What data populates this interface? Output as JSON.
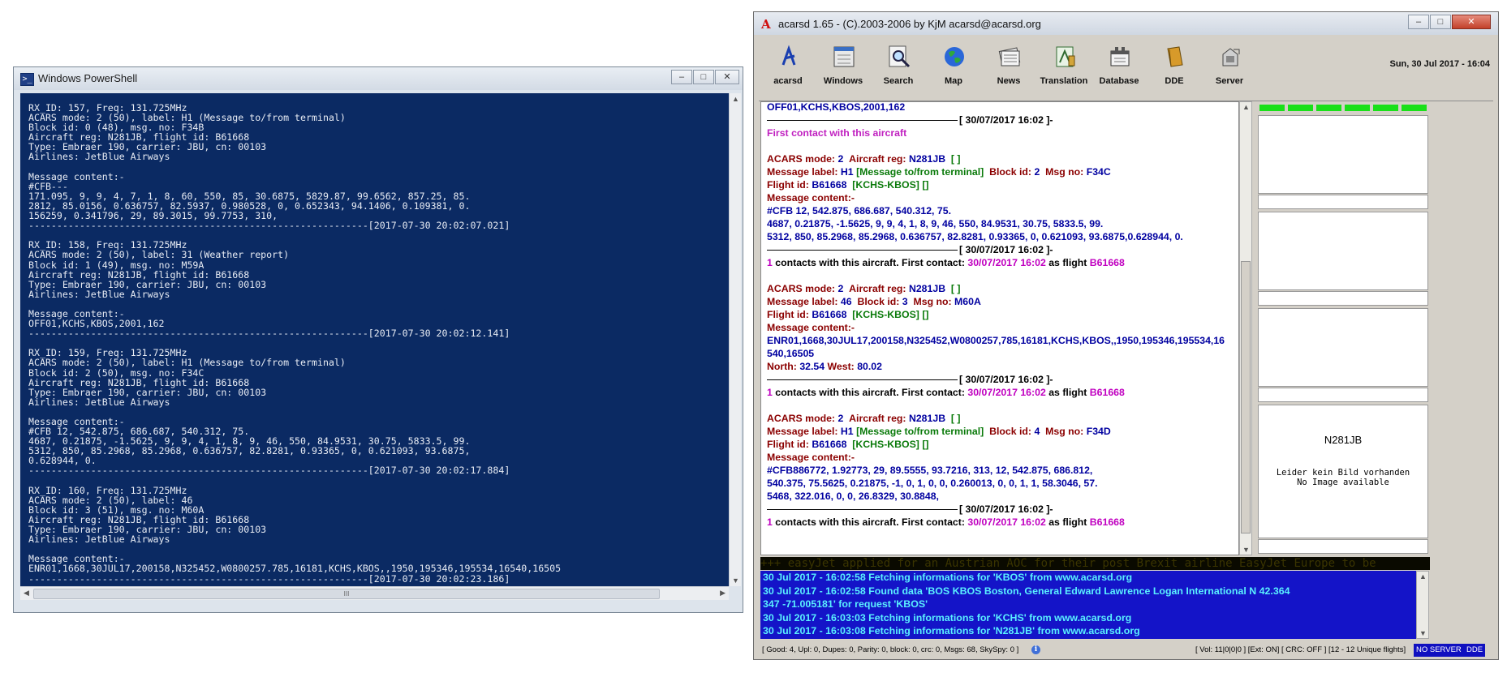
{
  "powershell": {
    "title": "Windows PowerShell",
    "lines": [
      "RX_ID: 157, Freq: 131.725MHz",
      "ACARS mode: 2 (50), label: H1 (Message to/from terminal)",
      "Block id: 0 (48), msg. no: F34B",
      "Aircraft reg: N281JB, flight id: B61668",
      "Type: Embraer 190, carrier: JBU, cn: 00103",
      "Airlines: JetBlue Airways",
      "",
      "Message content:-",
      "#CFB---",
      "171.095, 9, 9, 4, 7, 1, 8, 60, 550, 85, 30.6875, 5829.87, 99.6562, 857.25, 85.",
      "2812, 85.0156, 0.636757, 82.5937, 0.980528, 0, 0.652343, 94.1406, 0.109381, 0.",
      "156259, 0.341796, 29, 89.3015, 99.7753, 310,",
      "------------------------------------------------------------[2017-07-30 20:02:07.021]",
      "",
      "RX_ID: 158, Freq: 131.725MHz",
      "ACARS mode: 2 (50), label: 31 (Weather report)",
      "Block id: 1 (49), msg. no: M59A",
      "Aircraft reg: N281JB, flight id: B61668",
      "Type: Embraer 190, carrier: JBU, cn: 00103",
      "Airlines: JetBlue Airways",
      "",
      "Message content:-",
      "OFF01,KCHS,KBOS,2001,162",
      "------------------------------------------------------------[2017-07-30 20:02:12.141]",
      "",
      "RX_ID: 159, Freq: 131.725MHz",
      "ACARS mode: 2 (50), label: H1 (Message to/from terminal)",
      "Block id: 2 (50), msg. no: F34C",
      "Aircraft reg: N281JB, flight id: B61668",
      "Type: Embraer 190, carrier: JBU, cn: 00103",
      "Airlines: JetBlue Airways",
      "",
      "Message content:-",
      "#CFB 12, 542.875, 686.687, 540.312, 75.",
      "4687, 0.21875, -1.5625, 9, 9, 4, 1, 8, 9, 46, 550, 84.9531, 30.75, 5833.5, 99.",
      "5312, 850, 85.2968, 85.2968, 0.636757, 82.8281, 0.93365, 0, 0.621093, 93.6875,",
      "0.628944, 0.",
      "------------------------------------------------------------[2017-07-30 20:02:17.884]",
      "",
      "RX_ID: 160, Freq: 131.725MHz",
      "ACARS mode: 2 (50), label: 46",
      "Block id: 3 (51), msg. no: M60A",
      "Aircraft reg: N281JB, flight id: B61668",
      "Type: Embraer 190, carrier: JBU, cn: 00103",
      "Airlines: JetBlue Airways",
      "",
      "Message content:-",
      "ENR01,1668,30JUL17,200158,N325452,W0800257.785,16181,KCHS,KBOS,,1950,195346,195534,16540,16505",
      "------------------------------------------------------------[2017-07-30 20:02:23.186]"
    ],
    "scroll_grip": "III"
  },
  "acarsd": {
    "title": "acarsd 1.65 - (C).2003-2006 by KjM acarsd@acarsd.org",
    "toolbar": [
      {
        "label": "acarsd",
        "icon": "acarsd-logo-icon"
      },
      {
        "label": "Windows",
        "icon": "windows-icon"
      },
      {
        "label": "Search",
        "icon": "search-icon"
      },
      {
        "label": "Map",
        "icon": "globe-icon"
      },
      {
        "label": "News",
        "icon": "newspaper-icon"
      },
      {
        "label": "Translation",
        "icon": "translation-icon"
      },
      {
        "label": "Database",
        "icon": "database-icon"
      },
      {
        "label": "DDE",
        "icon": "dde-book-icon"
      },
      {
        "label": "Server",
        "icon": "server-icon"
      }
    ],
    "datetime": "Sun, 30 Jul 2017 - 16:04",
    "messages": {
      "top_line": "OFF01,KCHS,KBOS,2001,162",
      "first_stamp": "[ 30/07/2017 16:02 ]-",
      "first_contact": "First contact with this aircraft",
      "blocks": [
        {
          "mode_label": "ACARS mode:",
          "mode": "2",
          "reg_label": "Aircraft reg:",
          "reg": "N281JB",
          "reg_extra": "[ ]",
          "msglabel_label": "Message label:",
          "msglabel": "H1",
          "msglabel_desc": "[Message to/from terminal]",
          "block_label": "Block id:",
          "block": "2",
          "msgno_label": "Msg no:",
          "msgno": "F34C",
          "flight_label": "Flight id:",
          "flight": "B61668",
          "route": "[KCHS-KBOS]",
          "route_extra": "[]",
          "content_label": "Message content:-",
          "content_lines": [
            "#CFB 12, 542.875, 686.687, 540.312, 75.",
            "4687, 0.21875, -1.5625, 9, 9, 4, 1, 8, 9, 46, 550, 84.9531, 30.75, 5833.5, 99.",
            "5312, 850, 85.2968, 85.2968, 0.636757, 82.8281, 0.93365, 0, 0.621093, 93.6875,0.628944, 0."
          ],
          "stamp": "[ 30/07/2017 16:02 ]-",
          "contacts_count": "1",
          "contacts_text": "contacts with this aircraft. First contact:",
          "contacts_date": "30/07/2017 16:02",
          "contacts_as": "as flight",
          "contacts_flight": "B61668"
        },
        {
          "mode_label": "ACARS mode:",
          "mode": "2",
          "reg_label": "Aircraft reg:",
          "reg": "N281JB",
          "reg_extra": "[ ]",
          "msglabel_label": "Message label:",
          "msglabel": "46",
          "block_label": "Block id:",
          "block": "3",
          "msgno_label": "Msg no:",
          "msgno": "M60A",
          "flight_label": "Flight id:",
          "flight": "B61668",
          "route": "[KCHS-KBOS]",
          "route_extra": "[]",
          "content_label": "Message content:-",
          "content_lines": [
            "ENR01,1668,30JUL17,200158,N325452,W0800257,785,16181,KCHS,KBOS,,1950,195346,195534,16",
            "540,16505"
          ],
          "north_label": "North:",
          "north": "32.54",
          "west_label": "West:",
          "west": "80.02",
          "stamp": "[ 30/07/2017 16:02 ]-",
          "contacts_count": "1",
          "contacts_text": "contacts with this aircraft. First contact:",
          "contacts_date": "30/07/2017 16:02",
          "contacts_as": "as flight",
          "contacts_flight": "B61668"
        },
        {
          "mode_label": "ACARS mode:",
          "mode": "2",
          "reg_label": "Aircraft reg:",
          "reg": "N281JB",
          "reg_extra": "[ ]",
          "msglabel_label": "Message label:",
          "msglabel": "H1",
          "msglabel_desc": "[Message to/from terminal]",
          "block_label": "Block id:",
          "block": "4",
          "msgno_label": "Msg no:",
          "msgno": "F34D",
          "flight_label": "Flight id:",
          "flight": "B61668",
          "route": "[KCHS-KBOS]",
          "route_extra": "[]",
          "content_label": "Message content:-",
          "content_lines": [
            "#CFB886772, 1.92773, 29, 89.5555, 93.7216, 313, 12, 542.875, 686.812,",
            "540.375, 75.5625, 0.21875, -1, 0, 1, 0, 0, 0.260013, 0, 0, 1, 1, 58.3046, 57.",
            "5468, 322.016, 0, 0, 26.8329, 30.8848,"
          ],
          "stamp": "[ 30/07/2017 16:02 ]-",
          "contacts_count": "1",
          "contacts_text": "contacts with this aircraft. First contact:",
          "contacts_date": "30/07/2017 16:02",
          "contacts_as": "as flight",
          "contacts_flight": "B61668"
        }
      ]
    },
    "side": {
      "aircraft_reg": "N281JB",
      "no_image_de": "Leider kein Bild vorhanden",
      "no_image_en": "No Image available"
    },
    "ticker": "+++ easyJet applied for an Austrian AOC for their post Brexit airline EasyJet Europe to be",
    "log": [
      "30 Jul 2017 - 16:02:58 Fetching informations for 'KBOS' from www.acarsd.org",
      "30 Jul 2017 - 16:02:58 Found data 'BOS            KBOS      Boston, General Edward Lawrence Logan International          N          42.364",
      "347           -71.005181' for request 'KBOS'",
      "30 Jul 2017 - 16:03:03 Fetching informations for 'KCHS' from www.acarsd.org",
      "30 Jul 2017 - 16:03:08 Fetching informations for 'N281JB' from www.acarsd.org"
    ],
    "status": {
      "left": "[ Good: 4, Upl: 0, Dupes: 0, Parity: 0, block: 0, crc: 0, Msgs: 68, SkySpy: 0 ]",
      "mid": "[ Vol: 11|0|0|0 ]  [Ext: ON]  [ CRC: OFF ]  [12 - 12 Unique flights]",
      "no_server": "NO SERVER",
      "dde": "DDE"
    }
  },
  "colors": {
    "ps_bg": "#0b2a63",
    "log_bg": "#1414c8",
    "log_text": "#5af0ff",
    "signal": "#19e019"
  }
}
